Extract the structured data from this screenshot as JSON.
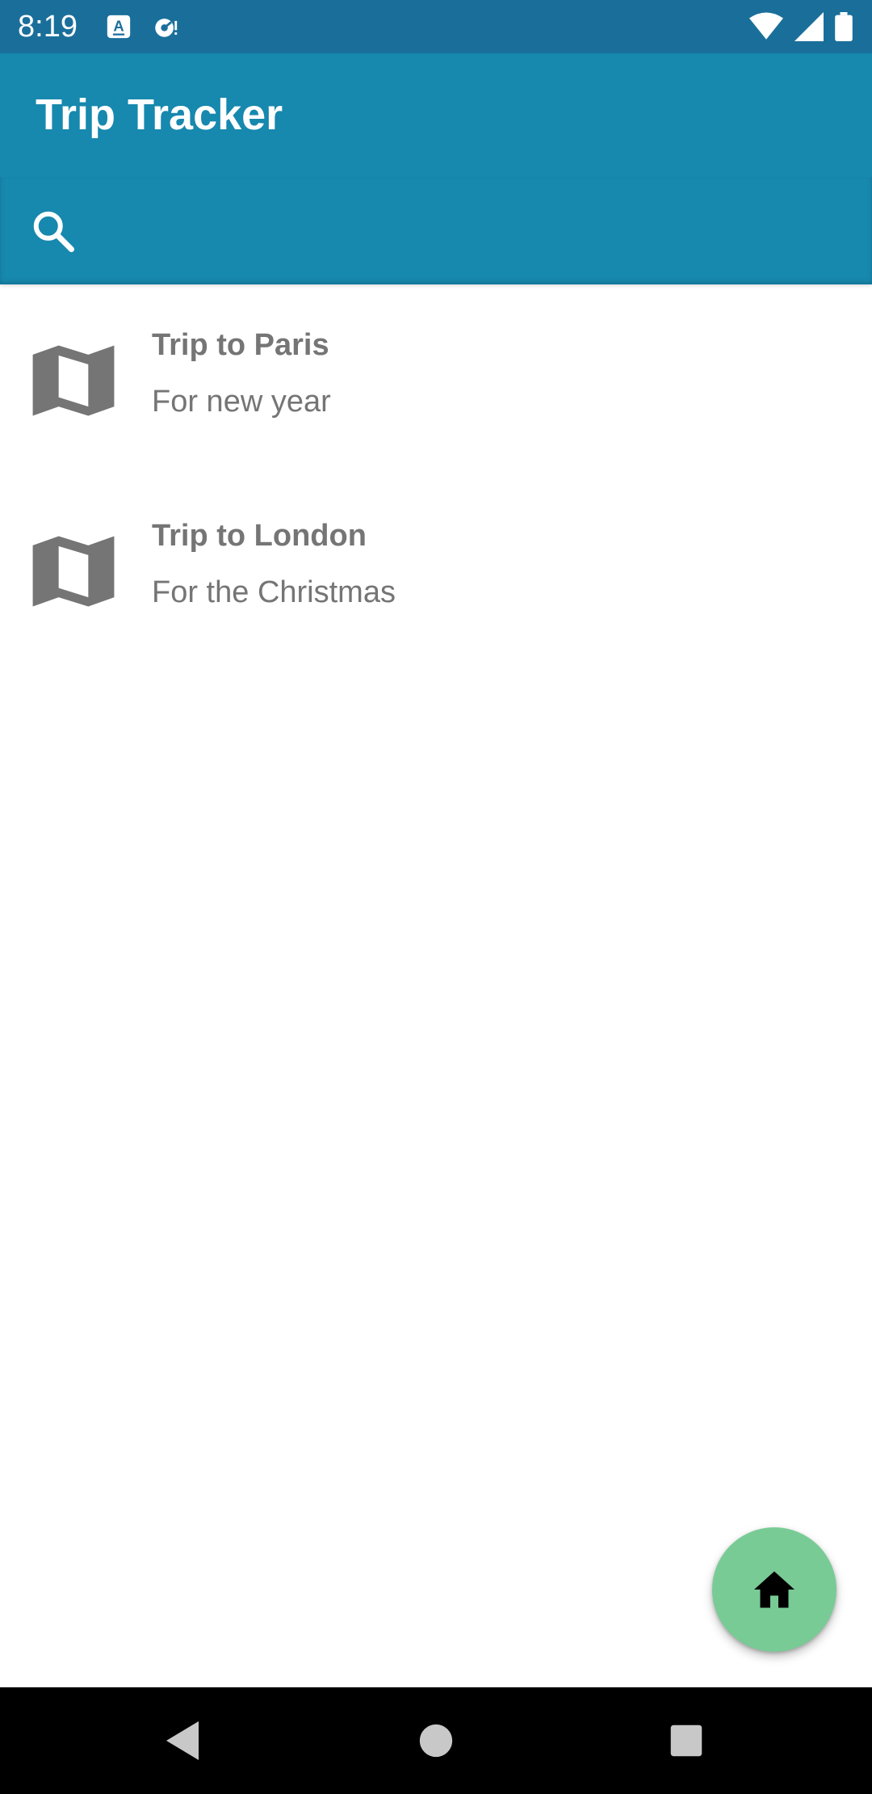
{
  "status_bar": {
    "time": "8:19",
    "icons": [
      "text-notification-icon",
      "sync-notification-icon",
      "wifi-icon",
      "signal-icon",
      "battery-icon"
    ]
  },
  "app_bar": {
    "title": "Trip Tracker",
    "color": "#1788ae"
  },
  "search": {
    "icon": "search-icon",
    "value": ""
  },
  "trips": [
    {
      "title": "Trip to Paris",
      "subtitle": "For new year",
      "icon": "map-icon"
    },
    {
      "title": "Trip to London",
      "subtitle": "For the Christmas",
      "icon": "map-icon"
    }
  ],
  "fab": {
    "icon": "home-icon",
    "color": "#78cb95"
  },
  "nav_bar": {
    "buttons": [
      "back-icon",
      "home-nav-icon",
      "recents-icon"
    ]
  }
}
